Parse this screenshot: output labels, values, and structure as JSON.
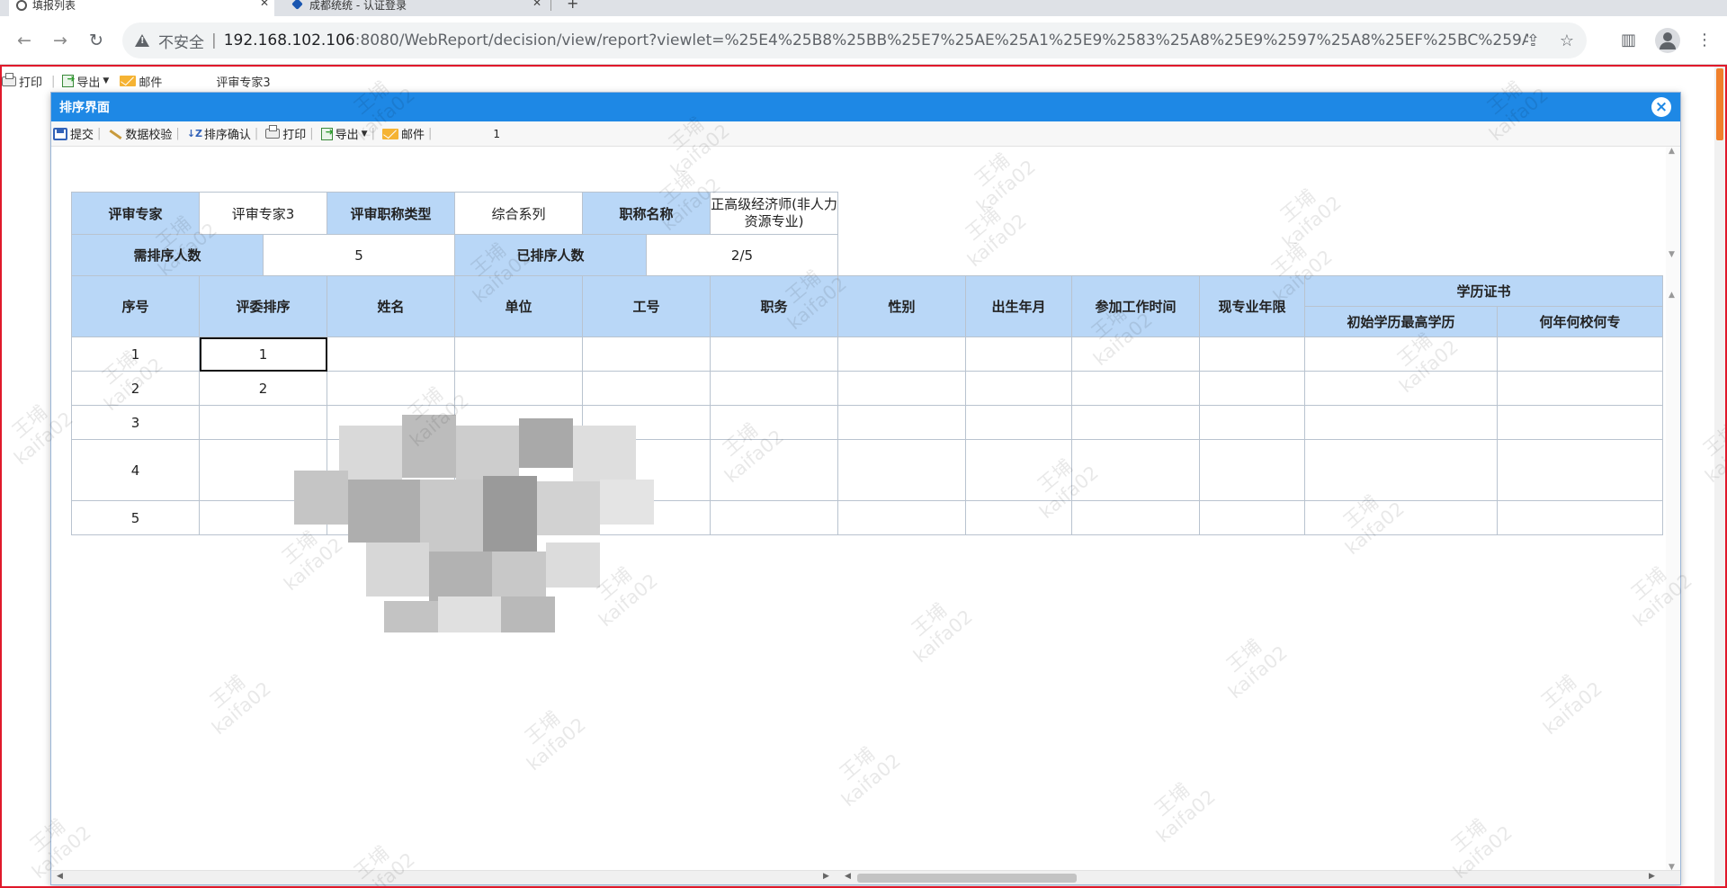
{
  "browser": {
    "tabs": [
      {
        "title": "填报列表",
        "active": true
      },
      {
        "title": "成都统统 - 认证登录",
        "active": false
      }
    ],
    "new_tab": "+",
    "address": {
      "security_label": "不安全",
      "host": "192.168.102.106",
      "rest": ":8080/WebReport/decision/view/report?viewlet=%25E4%25B8%25BB%25E7%25AE%25A1%25E9%2583%25A8%25E9%2597%25A8%25EF%25BC%259A%2..."
    }
  },
  "page_toolbar": {
    "print": "打印",
    "export": "导出",
    "mail": "邮件",
    "title": "评审专家3"
  },
  "dialog": {
    "title": "排序界面",
    "close": "×",
    "toolbar": {
      "submit": "提交",
      "validate": "数据校验",
      "sort_confirm": "排序确认",
      "print": "打印",
      "export": "导出",
      "mail": "邮件",
      "page": "1"
    },
    "info": {
      "expert_label": "评审专家",
      "expert_value": "评审专家3",
      "title_type_label": "评审职称类型",
      "title_type_value": "综合系列",
      "title_name_label": "职称名称",
      "title_name_value": "正高级经济师(非人力资源专业)",
      "need_count_label": "需排序人数",
      "need_count_value": "5",
      "done_count_label": "已排序人数",
      "done_count_value": "2/5"
    },
    "columns": {
      "seq": "序号",
      "rank": "评委排序",
      "name": "姓名",
      "unit": "单位",
      "job_no": "工号",
      "position": "职务",
      "gender": "性别",
      "birth": "出生年月",
      "work_start": "参加工作时间",
      "years": "现专业年限",
      "cert_group": "学历证书",
      "edu": "初始学历最高学历",
      "school": "何年何校何专"
    },
    "rows": [
      {
        "seq": "1",
        "rank": "1"
      },
      {
        "seq": "2",
        "rank": "2"
      },
      {
        "seq": "3",
        "rank": ""
      },
      {
        "seq": "4",
        "rank": ""
      },
      {
        "seq": "5",
        "rank": ""
      }
    ]
  },
  "watermark": {
    "line1": "王埔",
    "line2": "kaifa02"
  }
}
